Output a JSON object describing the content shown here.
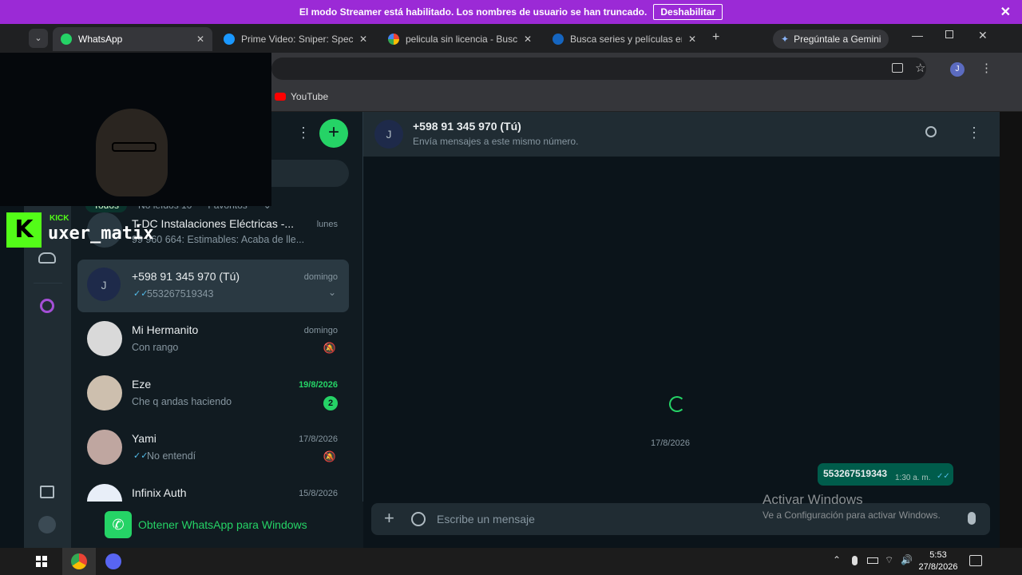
{
  "banner": {
    "text": "El modo Streamer está habilitado. Los nombres de usuario se han truncado.",
    "button": "Deshabilitar"
  },
  "tabs": [
    {
      "label": "WhatsApp"
    },
    {
      "label": "Prime Video: Sniper: Special C"
    },
    {
      "label": "pelicula sin licencia - Buscar c"
    },
    {
      "label": "Busca series y películas en Pa"
    }
  ],
  "gemini": "Pregúntale a Gemini",
  "bookmarks": {
    "youtube": "YouTube"
  },
  "overlay": {
    "kick": "KICK",
    "channel": "uxer_matix"
  },
  "sidebar": {
    "filters": [
      "Todos",
      "No leídos 10",
      "Favoritos"
    ],
    "chats": [
      {
        "name": "T-DC Instalaciones Eléctricas -...",
        "msg": "99 960 664: Estimables: Acaba de lle...",
        "date": "lunes"
      },
      {
        "name": "+598 91 345 970 (Tú)",
        "msg": "553267519343",
        "date": "domingo",
        "avatar": "J"
      },
      {
        "name": "Mi Hermanito",
        "msg": "Con rango",
        "date": "domingo"
      },
      {
        "name": "Eze",
        "msg": "Che q andas haciendo",
        "date": "19/8/2026",
        "unread": "2"
      },
      {
        "name": "Yami",
        "msg": "No entendí",
        "date": "17/8/2026"
      },
      {
        "name": "Infinix Auth",
        "msg": "",
        "date": "15/8/2026"
      }
    ],
    "banner": "Obtener WhatsApp para Windows"
  },
  "chat": {
    "avatar": "J",
    "name": "+598 91 345 970 (Tú)",
    "subtitle": "Envía mensajes a este mismo número.",
    "date_chip": "17/8/2026",
    "message": {
      "text": "553267519343",
      "time": "1:30 a. m."
    },
    "input_placeholder": "Escribe un mensaje"
  },
  "watermark": {
    "title": "Activar Windows",
    "sub": "Ve a Configuración para activar Windows."
  },
  "taskbar": {
    "time": "5:53",
    "date": "27/8/2026"
  },
  "colors": {
    "accent": "#25d366",
    "streamer": "#9b2ad6",
    "outgoing": "#005c4b"
  }
}
